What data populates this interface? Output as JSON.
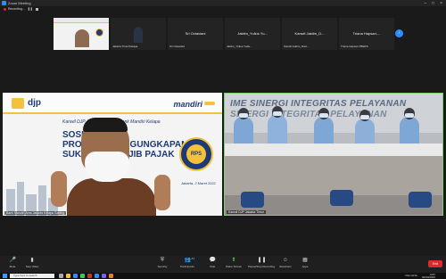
{
  "window": {
    "title": "Zoom Meeting"
  },
  "recording": {
    "label": "Recording..."
  },
  "strip": {
    "tiles": [
      {
        "name": ""
      },
      {
        "name": "Jakarta Timur/Kelapa"
      },
      {
        "name": "Sri Octaviani",
        "label": "Sri Octaviani"
      },
      {
        "name": "Jaktim_Yulius Yuda...",
        "label": "Jaktim_Yulius Yu..."
      },
      {
        "name": "Kanwil Jaktim_Diaz...",
        "label": "Kanwil Jaktim_D..."
      },
      {
        "name": "Triana Hapsari-TBERS",
        "label": "Triana Hapsari-..."
      }
    ]
  },
  "slide": {
    "djp": "djp",
    "mandiri": "mandiri",
    "line1": "Kanwil DJP Jakarta Timur & Bank Mandiri Kelapa",
    "title1": "SOSIALISASI",
    "title2": "PROGRAM PENGUNGKAPAN",
    "title3": "SUKARELA WAJIB PAJAK",
    "badge": "RPS",
    "date": "Jakarta, 2 Maret 2022",
    "speaker_name": "Bank Mandiri Area Jakarta Kelapa Gading"
  },
  "room": {
    "wall_text": "IME SINERGI INTEGRITAS PELAYANAN",
    "wall_text2": "SINERGI INTEGRITAS PELAYANAN",
    "name": "Kanwil DJP Jakarta Timur"
  },
  "toolbar": {
    "mute": "Mute",
    "stop_video": "Stop Video",
    "security": "Security",
    "participants": "Participants",
    "participants_count": "41",
    "chat": "Chat",
    "share": "Share Screen",
    "record": "Record",
    "pause_record": "Pause/Stop Recording",
    "reactions": "Reactions",
    "apps": "Apps",
    "end": "End"
  },
  "taskbar": {
    "search": "Type here to search",
    "time": "9:57",
    "date": "02/03/2022",
    "weather": "Rain",
    "lang": "ENG"
  }
}
